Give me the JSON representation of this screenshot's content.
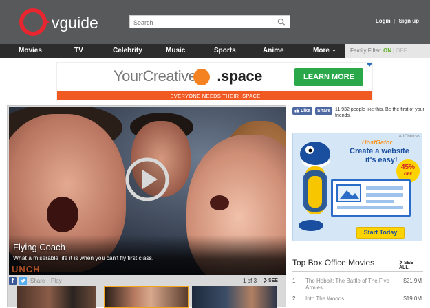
{
  "header": {
    "logo_text": "vguide",
    "search_placeholder": "Search",
    "login": "Login",
    "separator": "|",
    "signup": "Sign up"
  },
  "nav": {
    "items": [
      "Movies",
      "TV",
      "Celebrity",
      "Music",
      "Sports",
      "Anime",
      "More"
    ],
    "family_filter_label": "Family Filter:",
    "family_on": "ON",
    "family_separator": "|",
    "family_off": "OFF"
  },
  "ad_banner": {
    "text_light": "YourCreative",
    "text_bold": ".space",
    "button": "LEARN MORE",
    "tagline": "EVERYONE NEEDS THEIR .SPACE"
  },
  "player": {
    "title": "Flying Coach",
    "description": "What a miserable life it is when you can't fly first class.",
    "watermark": "UNCH",
    "share_label": "Share",
    "play_label": "Play",
    "page_count": "1 of 3",
    "see_all": "SEE ALL"
  },
  "social": {
    "like_label": "Like",
    "share_label": "Share",
    "text": "11,932 people like this. Be the first of your friends."
  },
  "side_ad": {
    "adchoices": "AdChoices",
    "brand": "HostGator",
    "headline1": "Create a website",
    "headline2": "it's easy!",
    "badge_value": "45%",
    "badge_sub": "OFF",
    "cta": "Start Today"
  },
  "box_office": {
    "title": "Top Box Office Movies",
    "see_all": "SEE ALL",
    "rows": [
      {
        "rank": "1",
        "name": "The Hobbit: The Battle of The Five Armies",
        "gross": "$21.9M"
      },
      {
        "rank": "2",
        "name": "Into The Woods",
        "gross": "$19.0M"
      }
    ]
  },
  "colors": {
    "header_bg": "#58595b",
    "nav_bg": "#2c2c2c",
    "logo_red": "#e8262f",
    "family_on": "#5fae29",
    "ad_green": "#2aa84a",
    "ad_orange": "#f05a22"
  }
}
